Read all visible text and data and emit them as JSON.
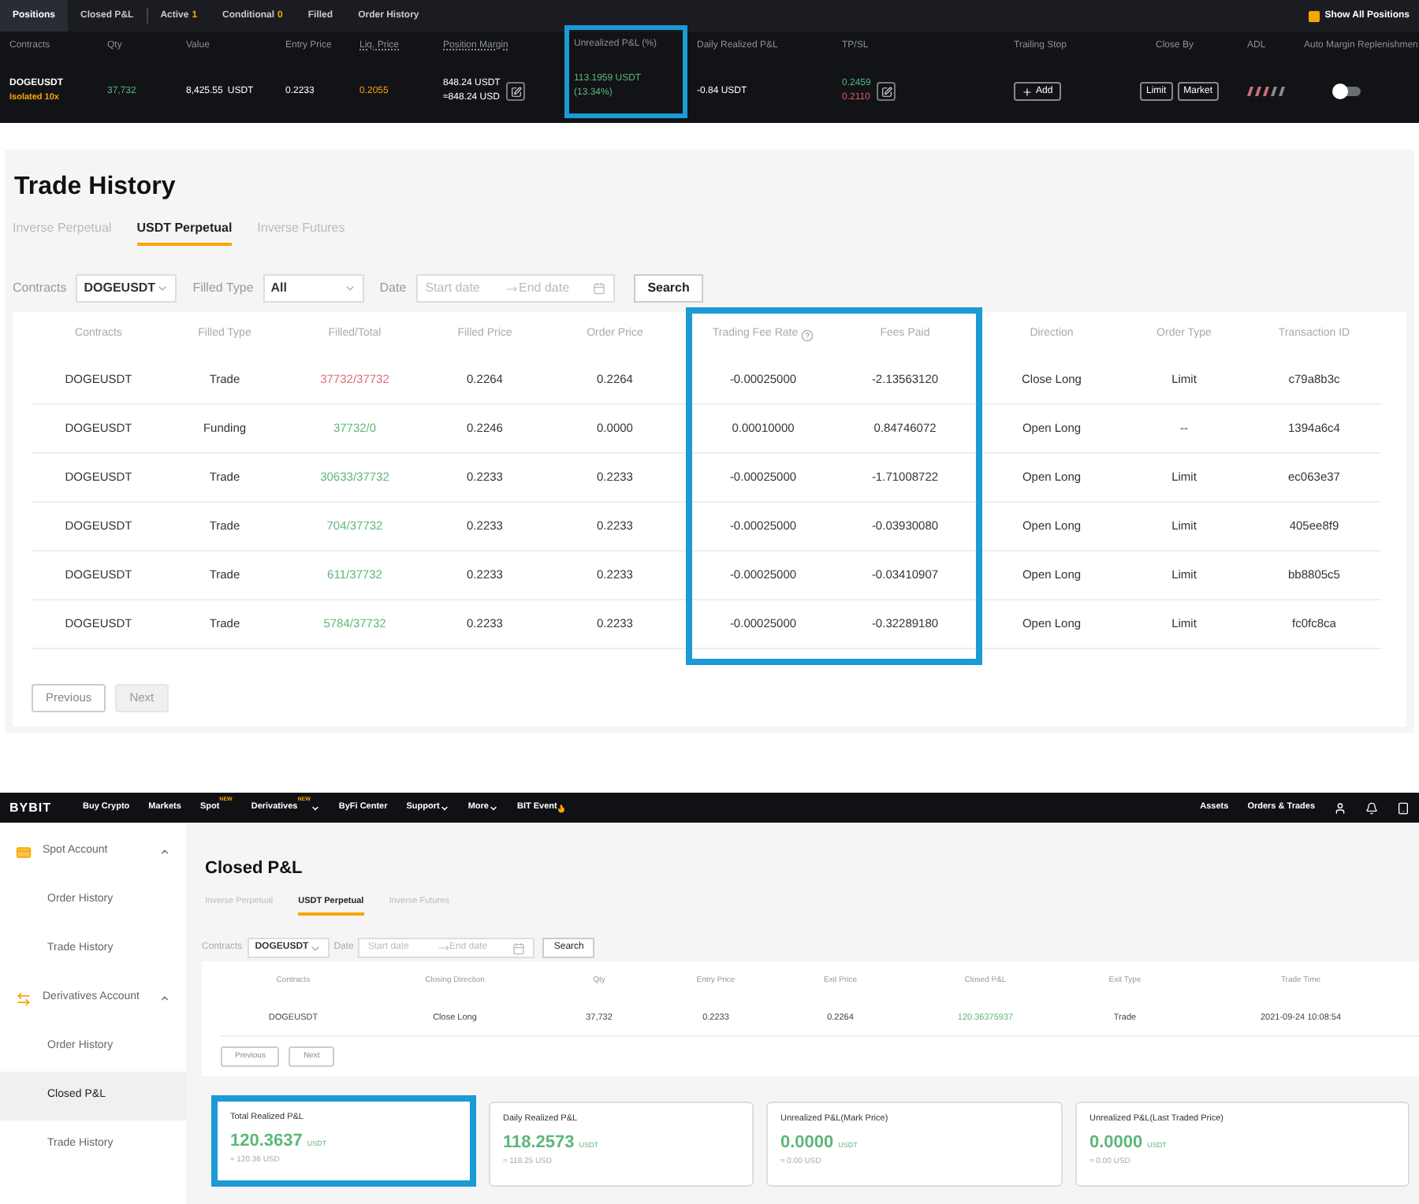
{
  "positions": {
    "tabs": [
      {
        "label": "Positions",
        "selected": true
      },
      {
        "label": "Closed P&L",
        "selected": false
      },
      {
        "label": "Active",
        "count": "1",
        "selected": false
      },
      {
        "label": "Conditional",
        "count": "0",
        "selected": false
      },
      {
        "label": "Filled",
        "selected": false
      },
      {
        "label": "Order History",
        "selected": false
      }
    ],
    "show_all": {
      "label": "Show All Positions",
      "checked": true
    },
    "columns": [
      {
        "label": "Contracts",
        "highlighted": false
      },
      {
        "label": "Qty",
        "highlighted": false
      },
      {
        "label": "Value",
        "highlighted": false
      },
      {
        "label": "Entry Price",
        "highlighted": false
      },
      {
        "label": "Liq. Price",
        "highlighted": false
      },
      {
        "label": "Position Margin",
        "highlighted": false
      },
      {
        "label": "Unrealized P&L (%)",
        "highlighted": true
      },
      {
        "label": "Daily Realized P&L",
        "highlighted": false
      },
      {
        "label": "TP/SL",
        "highlighted": false
      },
      {
        "label": "Trailing Stop",
        "highlighted": false
      },
      {
        "label": "Close By",
        "highlighted": false
      },
      {
        "label": "ADL",
        "highlighted": false
      },
      {
        "label": "Auto Margin Replenishmen",
        "highlighted": false
      }
    ],
    "row": {
      "contract": "DOGEUSDT",
      "margin_mode": "Isolated 10x",
      "qty": "37,732",
      "value": "8,425.55",
      "value_unit": "USDT",
      "entry_price": "0.2233",
      "liq_price": "0.2055",
      "margin": "848.24 USDT",
      "margin_usd": "≈848.24 USD",
      "unrealized": "113.1959 USDT",
      "unrealized_pct": "(13.34%)",
      "daily_realized": "-0.84 USDT",
      "take_profit": "0.2459",
      "stop_loss": "0.2110",
      "trailing_button": "Add",
      "close_buttons": [
        "Limit",
        "Market"
      ],
      "auto_margin_on": false
    }
  },
  "trade_history": {
    "title": "Trade History",
    "tabs": [
      {
        "label": "Inverse Perpetual",
        "selected": false
      },
      {
        "label": "USDT Perpetual",
        "selected": true
      },
      {
        "label": "Inverse Futures",
        "selected": false
      }
    ],
    "filters": {
      "contracts_label": "Contracts",
      "contract": "DOGEUSDT",
      "filled_type_label": "Filled Type",
      "filled_type": "All",
      "date_label": "Date",
      "start_placeholder": "Start date",
      "end_placeholder": "End date",
      "search": "Search"
    },
    "columns": [
      {
        "label": "Contracts",
        "highlighted": false
      },
      {
        "label": "Filled Type",
        "highlighted": false
      },
      {
        "label": "Filled/Total",
        "highlighted": false
      },
      {
        "label": "Filled Price",
        "highlighted": false
      },
      {
        "label": "Order Price",
        "highlighted": false
      },
      {
        "label": "Trading Fee Rate",
        "highlighted": true,
        "info": true
      },
      {
        "label": "Fees Paid",
        "highlighted": true
      },
      {
        "label": "Direction",
        "highlighted": false
      },
      {
        "label": "Order Type",
        "highlighted": false
      },
      {
        "label": "Transaction ID",
        "highlighted": false
      }
    ],
    "rows": [
      {
        "color": "#d9707c",
        "cells": [
          "DOGEUSDT",
          "Trade",
          "37732/37732",
          "0.2264",
          "0.2264",
          "-0.00025000",
          "-2.13563120",
          "Close Long",
          "Limit",
          "c79a8b3c"
        ]
      },
      {
        "color": "#5cb77a",
        "cells": [
          "DOGEUSDT",
          "Funding",
          "37732/0",
          "0.2246",
          "0.0000",
          "0.00010000",
          "0.84746072",
          "Open Long",
          "--",
          "1394a6c4"
        ]
      },
      {
        "color": "#5cb77a",
        "cells": [
          "DOGEUSDT",
          "Trade",
          "30633/37732",
          "0.2233",
          "0.2233",
          "-0.00025000",
          "-1.71008722",
          "Open Long",
          "Limit",
          "ec063e37"
        ]
      },
      {
        "color": "#5cb77a",
        "cells": [
          "DOGEUSDT",
          "Trade",
          "704/37732",
          "0.2233",
          "0.2233",
          "-0.00025000",
          "-0.03930080",
          "Open Long",
          "Limit",
          "405ee8f9"
        ]
      },
      {
        "color": "#5cb77a",
        "cells": [
          "DOGEUSDT",
          "Trade",
          "611/37732",
          "0.2233",
          "0.2233",
          "-0.00025000",
          "-0.03410907",
          "Open Long",
          "Limit",
          "bb8805c5"
        ]
      },
      {
        "color": "#5cb77a",
        "cells": [
          "DOGEUSDT",
          "Trade",
          "5784/37732",
          "0.2233",
          "0.2233",
          "-0.00025000",
          "-0.32289180",
          "Open Long",
          "Limit",
          "fc0fc8ca"
        ]
      }
    ],
    "pagination": [
      {
        "label": "Previous",
        "disabled": false
      },
      {
        "label": "Next",
        "disabled": true
      }
    ]
  },
  "nav": {
    "logo": "BYBIT",
    "items": [
      {
        "label": "Buy Crypto",
        "kind": "link"
      },
      {
        "label": "Markets",
        "kind": "link"
      },
      {
        "label": "Spot",
        "kind": "link",
        "badge": "NEW"
      },
      {
        "label": "Derivatives",
        "kind": "menu",
        "badge": "NEW"
      },
      {
        "label": "ByFi Center",
        "kind": "link"
      },
      {
        "label": "Support",
        "kind": "menu"
      },
      {
        "label": "More",
        "kind": "menu"
      },
      {
        "label": "BIT Event",
        "kind": "event"
      }
    ],
    "right": [
      "Assets",
      "Orders & Trades"
    ]
  },
  "sidebar": {
    "groups": [
      {
        "label": "Spot Account",
        "kind": "card",
        "expanded": true,
        "children": [
          {
            "label": "Order History",
            "selected": false
          },
          {
            "label": "Trade History",
            "selected": false
          }
        ]
      },
      {
        "label": "Derivatives Account",
        "kind": "transfer",
        "expanded": true,
        "children": [
          {
            "label": "Order History",
            "selected": false
          },
          {
            "label": "Closed P&L",
            "selected": true
          },
          {
            "label": "Trade History",
            "selected": false
          }
        ]
      }
    ]
  },
  "closed_pnl": {
    "title": "Closed P&L",
    "tabs": [
      {
        "label": "Inverse Perpetual",
        "selected": false
      },
      {
        "label": "USDT Perpetual",
        "selected": true
      },
      {
        "label": "Inverse Futures",
        "selected": false
      }
    ],
    "filters": {
      "contracts_label": "Contracts",
      "contract": "DOGEUSDT",
      "date_label": "Date",
      "start_placeholder": "Start date",
      "end_placeholder": "End date",
      "search": "Search"
    },
    "columns": [
      "Contracts",
      "Closing Direction",
      "Qty",
      "Entry Price",
      "Exit Price",
      "Closed P&L",
      "Exit Type",
      "Trade Time"
    ],
    "rows": [
      {
        "cells": [
          "DOGEUSDT",
          "Close Long",
          "37,732",
          "0.2233",
          "0.2264",
          "120.36375937",
          "Trade",
          "2021-09-24 10:08:54"
        ]
      }
    ],
    "pagination": [
      {
        "label": "Previous",
        "disabled": false
      },
      {
        "label": "Next",
        "disabled": false
      }
    ],
    "summary": [
      {
        "label": "Total Realized P&L",
        "value": "120.3637",
        "unit": "USDT",
        "usd": "≈ 120.36 USD",
        "highlighted": true
      },
      {
        "label": "Daily Realized P&L",
        "value": "118.2573",
        "unit": "USDT",
        "usd": "≈ 118.25 USD",
        "highlighted": false
      },
      {
        "label": "Unrealized P&L(Mark Price)",
        "value": "0.0000",
        "unit": "USDT",
        "usd": "≈ 0.00 USD",
        "highlighted": false
      },
      {
        "label": "Unrealized P&L(Last Traded Price)",
        "value": "0.0000",
        "unit": "USDT",
        "usd": "≈ 0.00 USD",
        "highlighted": false
      }
    ]
  }
}
